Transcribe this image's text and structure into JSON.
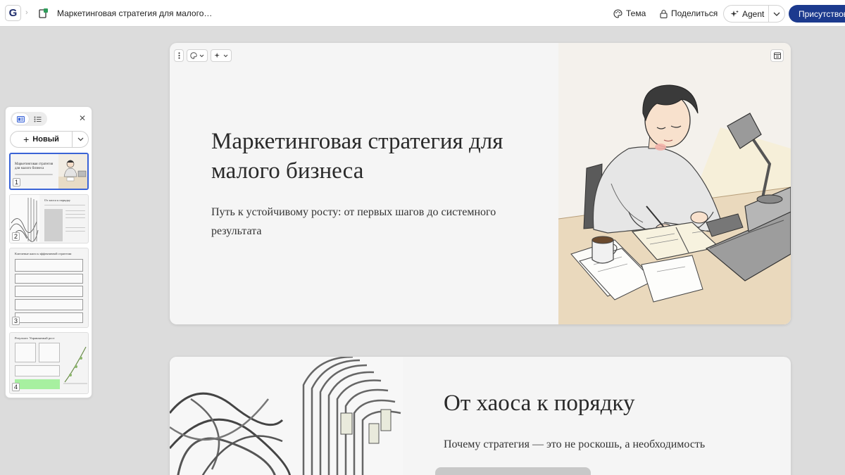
{
  "header": {
    "logo_letter": "G",
    "doc_title": "Маркетинговая стратегия для малого…",
    "theme_label": "Тема",
    "share_label": "Поделиться",
    "agent_label": "Agent",
    "present_label": "Присутствовать"
  },
  "panel": {
    "new_label": "Новый",
    "close_glyph": "✕",
    "thumbnails": [
      {
        "number": "1",
        "title": "Маркетинговая стратегия для малого бизнеса",
        "selected": true
      },
      {
        "number": "2",
        "title": "От хаоса к порядку"
      },
      {
        "number": "3",
        "title": "Ключевые шаги к эффективной стратегии"
      },
      {
        "number": "4",
        "title": "Результат: Управляемый рост"
      }
    ]
  },
  "slides": [
    {
      "title": "Маркетинговая стратегия для малого бизнеса",
      "subtitle": "Путь к устойчивому росту: от первых шагов до системного результата",
      "image": "person-writing-at-desk-illustration"
    },
    {
      "title": "От хаоса к порядку",
      "subtitle": "Почему стратегия — это не роскошь, а необходимость",
      "image": "tangled-cables-illustration"
    }
  ],
  "icons": {
    "theme": "palette-icon",
    "share": "lock-icon",
    "agent": "sparkle-icon",
    "present": "play-icon"
  },
  "colors": {
    "accent": "#1c3a8e",
    "selected_thumb": "#3a63d6",
    "canvas": "#dcdcdc"
  }
}
